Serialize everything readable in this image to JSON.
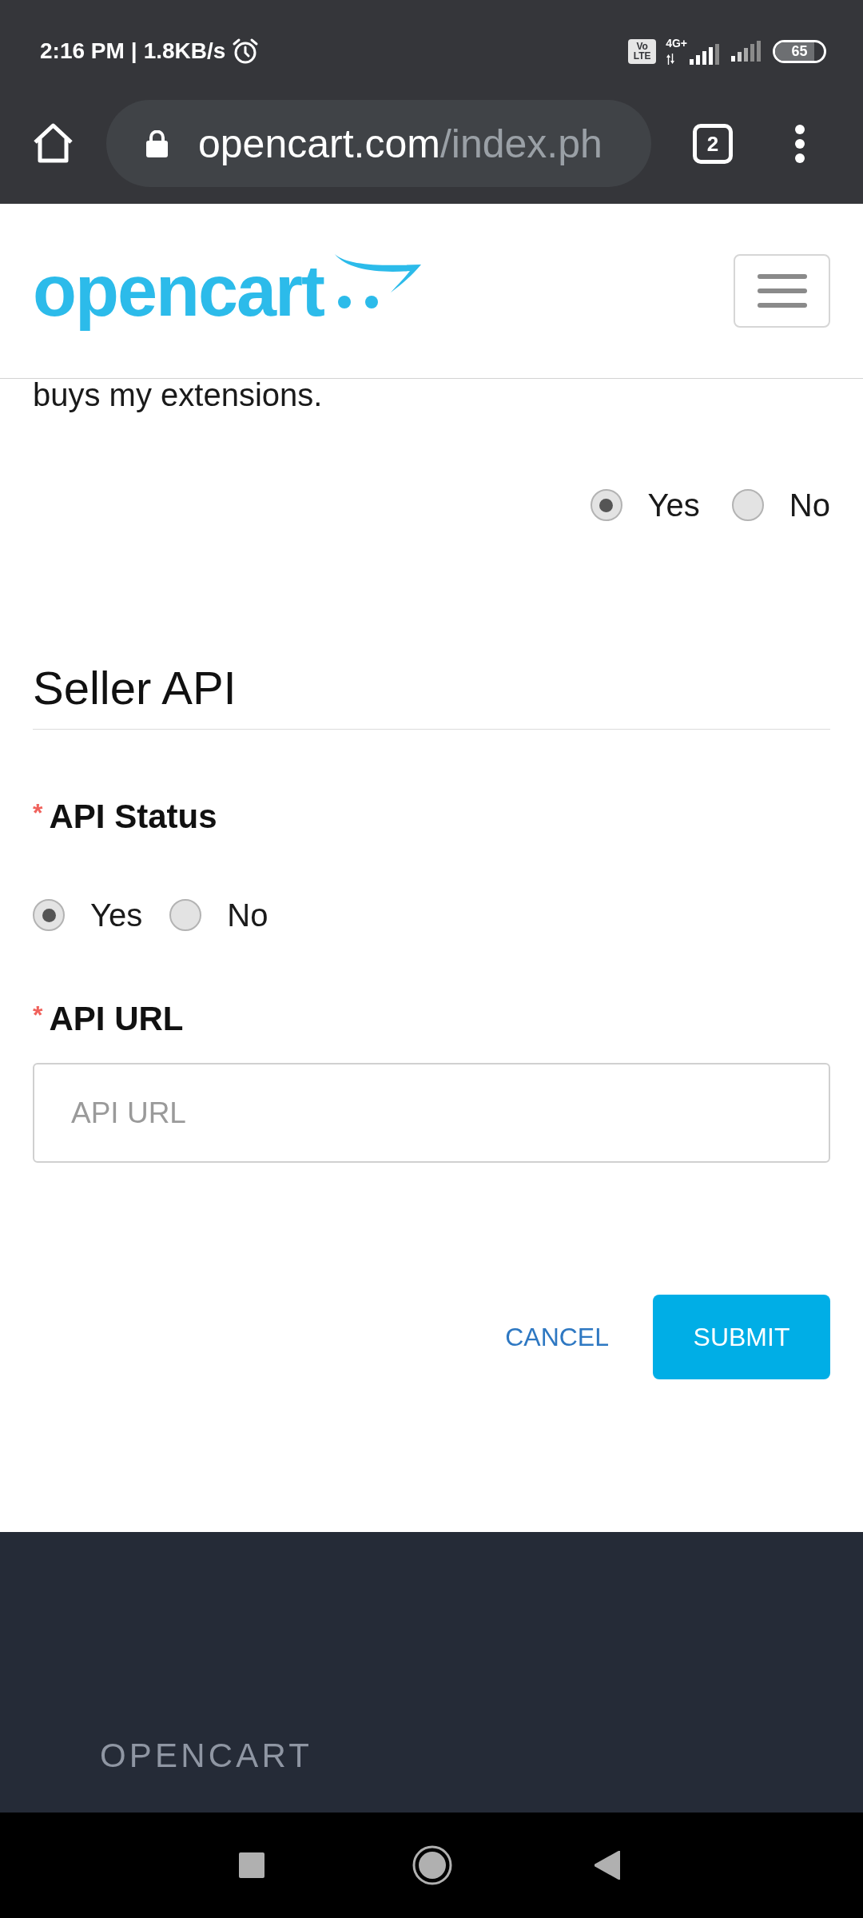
{
  "status_bar": {
    "time": "2:16 PM",
    "separator": "|",
    "speed": "1.8KB/s",
    "volte": [
      "Vo",
      "LTE"
    ],
    "network": "4G+",
    "battery": "65"
  },
  "browser_bar": {
    "url_host": "opencart.com",
    "url_path": "/index.ph",
    "tab_count": "2"
  },
  "header": {
    "logo": "opencart"
  },
  "intro": {
    "text": "buys my extensions.",
    "options": [
      {
        "label": "Yes",
        "selected": true
      },
      {
        "label": "No",
        "selected": false
      }
    ]
  },
  "section": {
    "title": "Seller API",
    "fields": [
      {
        "kind": "radio",
        "required_mark": "*",
        "label": "API Status",
        "options": [
          {
            "label": "Yes",
            "selected": true
          },
          {
            "label": "No",
            "selected": false
          }
        ]
      },
      {
        "kind": "text",
        "required_mark": "*",
        "label": "API URL",
        "placeholder": "API URL"
      }
    ]
  },
  "actions": [
    {
      "kind": "link",
      "label": "CANCEL"
    },
    {
      "kind": "primary",
      "label": "SUBMIT"
    }
  ],
  "footer": {
    "heading": "OPENCART"
  }
}
